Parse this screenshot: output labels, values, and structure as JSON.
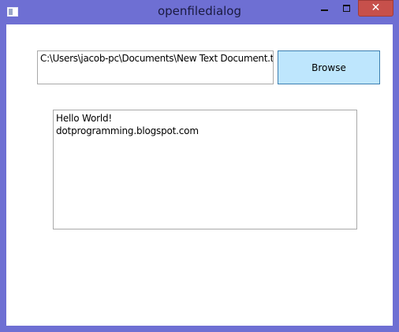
{
  "window": {
    "title": "openfiledialog",
    "close_glyph": "✕",
    "icons": {
      "app": "app-window-icon",
      "minimize": "minimize-icon",
      "maximize": "maximize-icon",
      "close": "close-icon"
    }
  },
  "form": {
    "file_path": "C:\\Users\\jacob-pc\\Documents\\New Text Document.txt",
    "browse_label": "Browse",
    "content_lines": [
      "Hello World!",
      "dotprogramming.blogspot.com"
    ]
  },
  "colors": {
    "frame": "#6e6fd3",
    "close_button": "#c7504b",
    "browse_button_bg": "#bee6fd",
    "browse_button_border": "#3c7fb1"
  }
}
